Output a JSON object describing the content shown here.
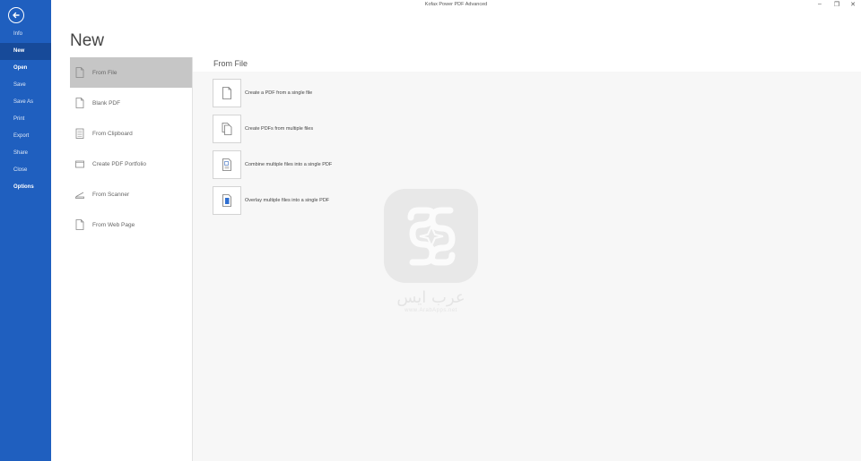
{
  "window": {
    "title": "Kofax Power PDF Advanced",
    "controls": {
      "minimize": "–",
      "restore": "❐",
      "close": "✕"
    }
  },
  "nav": {
    "back_icon": "back-arrow-icon",
    "items": [
      {
        "label": "Info",
        "state": "normal"
      },
      {
        "label": "New",
        "state": "active"
      },
      {
        "label": "Open",
        "state": "bold"
      },
      {
        "label": "Save",
        "state": "normal"
      },
      {
        "label": "Save As",
        "state": "normal"
      },
      {
        "label": "Print",
        "state": "normal"
      },
      {
        "label": "Export",
        "state": "normal"
      },
      {
        "label": "Share",
        "state": "normal"
      },
      {
        "label": "Close",
        "state": "normal"
      },
      {
        "label": "Options",
        "state": "bold"
      }
    ]
  },
  "page": {
    "title": "New"
  },
  "categories": [
    {
      "label": "From File",
      "icon": "document-icon",
      "selected": true
    },
    {
      "label": "Blank PDF",
      "icon": "blank-page-icon",
      "selected": false
    },
    {
      "label": "From Clipboard",
      "icon": "clipboard-icon",
      "selected": false
    },
    {
      "label": "Create PDF Portfolio",
      "icon": "folder-icon",
      "selected": false
    },
    {
      "label": "From Scanner",
      "icon": "scanner-icon",
      "selected": false
    },
    {
      "label": "From Web Page",
      "icon": "web-page-icon",
      "selected": false
    }
  ],
  "content": {
    "header": "From File",
    "options": [
      {
        "label": "Create a PDF from a single file",
        "icon": "single-file-icon"
      },
      {
        "label": "Create PDFs from multiple files",
        "icon": "multiple-files-icon"
      },
      {
        "label": "Combine multiple files into a single PDF",
        "icon": "combine-files-icon"
      },
      {
        "label": "Overlay multiple files into a single PDF",
        "icon": "overlay-files-icon"
      }
    ]
  },
  "watermark": {
    "text": "عرب ايس",
    "url": "www.ArabApps.net"
  },
  "colors": {
    "nav_bg": "#1f5fbf",
    "nav_active": "#174a99",
    "selected_category": "#c6c6c6",
    "content_bg": "#f7f7f7"
  }
}
